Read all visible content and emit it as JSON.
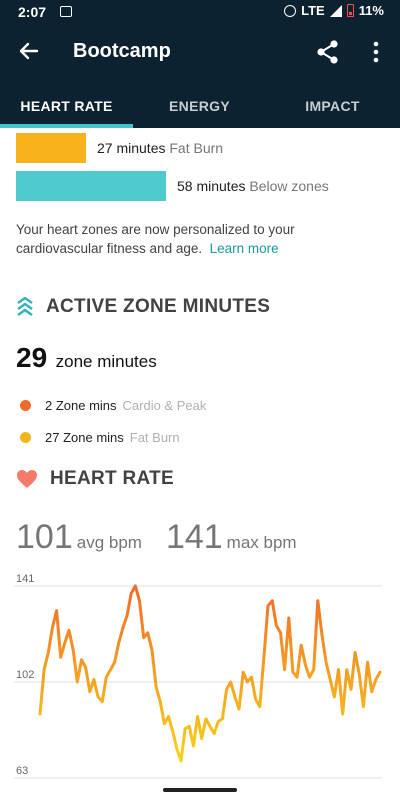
{
  "status_bar": {
    "time": "2:07",
    "network": "LTE",
    "battery": "11%"
  },
  "app_bar": {
    "title": "Bootcamp"
  },
  "tabs": [
    {
      "label": "HEART RATE",
      "active": true
    },
    {
      "label": "ENERGY",
      "active": false
    },
    {
      "label": "IMPACT",
      "active": false
    }
  ],
  "zones": [
    {
      "minutes": "27 minutes",
      "zone": "Fat Burn",
      "color": "#f7b21c"
    },
    {
      "minutes": "58 minutes",
      "zone": "Below zones",
      "color": "#4ec9cd"
    }
  ],
  "info": {
    "text": "Your heart zones are now personalized to your cardiovascular fitness and age.",
    "link": "Learn more"
  },
  "azm": {
    "title": "ACTIVE ZONE MINUTES",
    "total": "29",
    "total_unit": "zone minutes",
    "rows": [
      {
        "label": "2 Zone mins",
        "zone": "Cardio & Peak",
        "color": "#f26b2a"
      },
      {
        "label": "27 Zone mins",
        "zone": "Fat Burn",
        "color": "#f4b51a"
      }
    ]
  },
  "heart_rate": {
    "title": "HEART RATE",
    "avg": "101",
    "avg_label": "avg bpm",
    "max": "141",
    "max_label": "max bpm"
  },
  "chart_data": {
    "type": "line",
    "y_ticks": [
      "141",
      "102",
      "63"
    ],
    "ylim": [
      63,
      141
    ],
    "grid": true,
    "series": [
      {
        "values": [
          89,
          107,
          114,
          124,
          131,
          112,
          118,
          123,
          115,
          102,
          111,
          108,
          98,
          103,
          96,
          94,
          104,
          107,
          110,
          118,
          124,
          129,
          138,
          141,
          135,
          120,
          122,
          115,
          100,
          94,
          85,
          88,
          82,
          75,
          70,
          83,
          84,
          76,
          88,
          79,
          87,
          84,
          81,
          86,
          87,
          99,
          102,
          96,
          91,
          106,
          102,
          104,
          95,
          92,
          112,
          133,
          135,
          125,
          122,
          107,
          128,
          106,
          104,
          117,
          109,
          104,
          107,
          135,
          121,
          110,
          103,
          96,
          107,
          89,
          107,
          99,
          114,
          105,
          92,
          110,
          98,
          103,
          106
        ]
      }
    ]
  },
  "colors": {
    "header": "#0d2230",
    "accent": "#43c6c9",
    "line_high": "#f26b2a",
    "line_low": "#f7c31c"
  }
}
